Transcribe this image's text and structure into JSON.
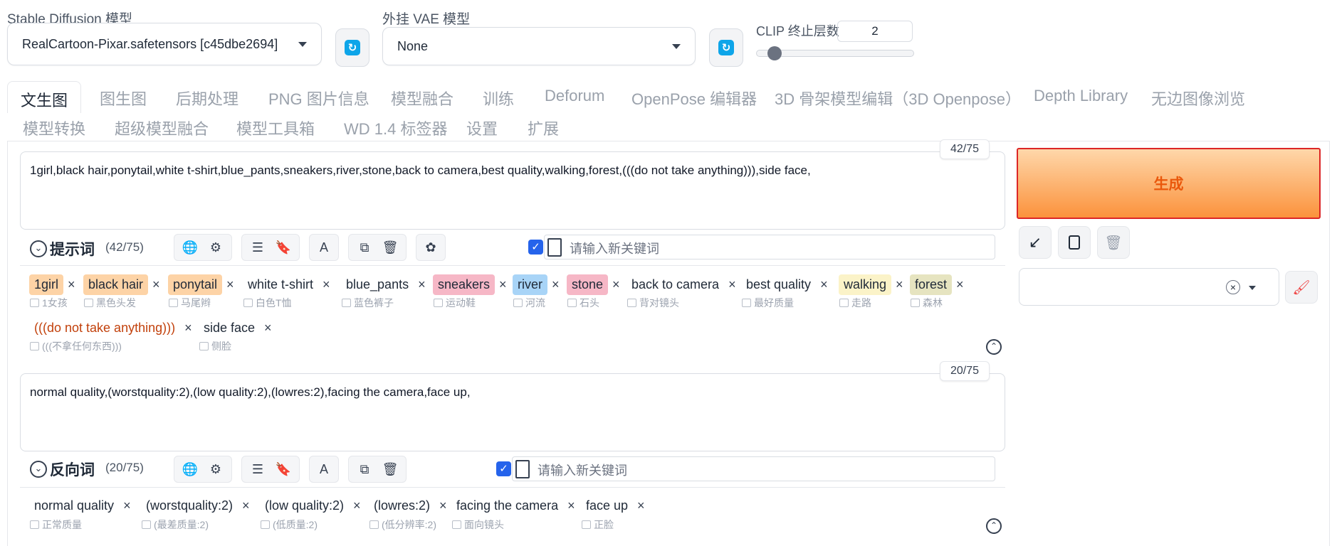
{
  "models": {
    "sd_label": "Stable Diffusion 模型",
    "sd_value": "RealCartoon-Pixar.safetensors [c45dbe2694]",
    "vae_label": "外挂 VAE 模型",
    "vae_value": "None",
    "clip_label": "CLIP 终止层数",
    "clip_value": "2"
  },
  "tabs": [
    "文生图",
    "图生图",
    "后期处理",
    "PNG 图片信息",
    "模型融合",
    "训练",
    "Deforum",
    "OpenPose 编辑器",
    "3D 骨架模型编辑（3D Openpose）",
    "Depth Library",
    "无边图像浏览",
    "模型转换",
    "超级模型融合",
    "模型工具箱",
    "WD 1.4 标签器",
    "设置",
    "扩展"
  ],
  "prompt": {
    "counter": "42/75",
    "text": "1girl,black hair,ponytail,white t-shirt,blue_pants,sneakers,river,stone,back to camera,best quality,walking,forest,(((do not take anything))),side face,",
    "label": "提示词",
    "count": "(42/75)",
    "keyword_placeholder": "请输入新关键词",
    "tags": [
      {
        "en": "1girl",
        "zh": "1女孩",
        "color": "#fdd3a6"
      },
      {
        "en": "black hair",
        "zh": "黑色头发",
        "color": "#fdd3a6"
      },
      {
        "en": "ponytail",
        "zh": "马尾辫",
        "color": "#fdd3a6"
      },
      {
        "en": "white t-shirt",
        "zh": "白色T恤",
        "color": ""
      },
      {
        "en": "blue_pants",
        "zh": "蓝色裤子",
        "color": ""
      },
      {
        "en": "sneakers",
        "zh": "运动鞋",
        "color": "#f6b7c6"
      },
      {
        "en": "river",
        "zh": "河流",
        "color": "#a8d4f7"
      },
      {
        "en": "stone",
        "zh": "石头",
        "color": "#f6b7c6"
      },
      {
        "en": "back to camera",
        "zh": "背对镜头",
        "color": ""
      },
      {
        "en": "best quality",
        "zh": "最好质量",
        "color": ""
      },
      {
        "en": "walking",
        "zh": "走路",
        "color": "#fbf3c8"
      },
      {
        "en": "forest",
        "zh": "森林",
        "color": "#e6e4c0"
      },
      {
        "en": "(((do not take anything)))",
        "zh": "(((不拿任何东西)))",
        "color": ""
      },
      {
        "en": "side face",
        "zh": "侧脸",
        "color": ""
      }
    ]
  },
  "negative": {
    "counter": "20/75",
    "text": "normal quality,(worstquality:2),(low quality:2),(lowres:2),facing the camera,face up,",
    "label": "反向词",
    "count": "(20/75)",
    "keyword_placeholder": "请输入新关键词",
    "tags": [
      {
        "en": "normal quality",
        "zh": "正常质量"
      },
      {
        "en": "(worstquality:2)",
        "zh": "(最差质量:2)"
      },
      {
        "en": "(low quality:2)",
        "zh": "(低质量:2)"
      },
      {
        "en": "(lowres:2)",
        "zh": "(低分辨率:2)"
      },
      {
        "en": "facing the camera",
        "zh": "面向镜头"
      },
      {
        "en": "face up",
        "zh": "正脸"
      }
    ]
  },
  "generate": {
    "label": "生成",
    "color": "#f97316"
  },
  "icons": {
    "toolbar": [
      "globe-icon",
      "gear-icon",
      "list-icon",
      "bookmark-icon",
      "translate-icon",
      "copy-icon",
      "trash-icon",
      "openai-icon"
    ],
    "actions": [
      "arrow-down-left-icon",
      "clipboard-icon",
      "trash-icon"
    ]
  }
}
